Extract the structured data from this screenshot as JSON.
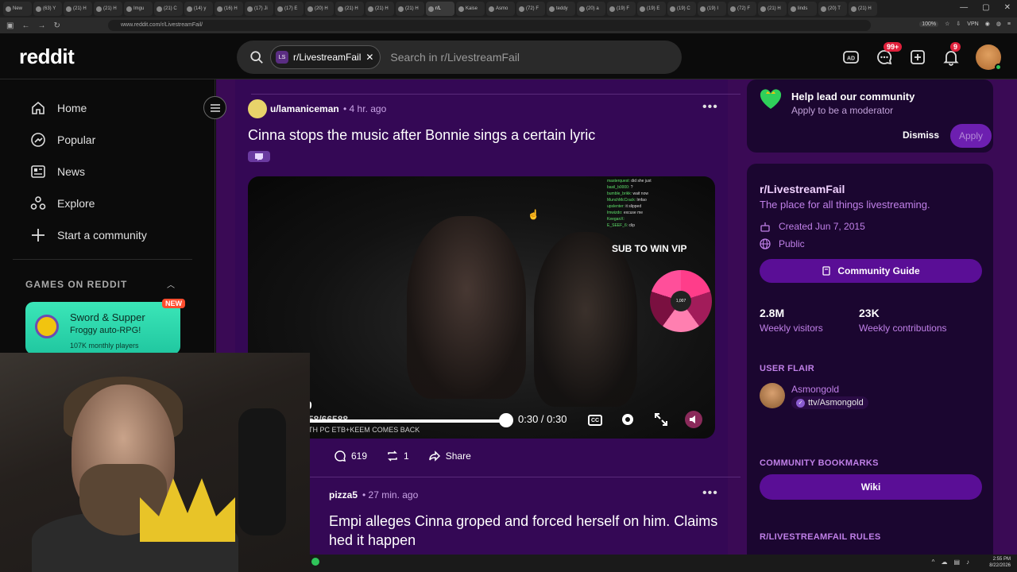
{
  "browser": {
    "tabs": [
      {
        "label": "New",
        "active": false
      },
      {
        "label": "(63) Y",
        "active": false
      },
      {
        "label": "(21) H",
        "active": false
      },
      {
        "label": "(21) H",
        "active": false
      },
      {
        "label": "Imgu",
        "active": false
      },
      {
        "label": "(21) C",
        "active": false
      },
      {
        "label": "(14) y",
        "active": false
      },
      {
        "label": "(16) H",
        "active": false
      },
      {
        "label": "(17) Ji",
        "active": false
      },
      {
        "label": "(17) E",
        "active": false
      },
      {
        "label": "(20) H",
        "active": false
      },
      {
        "label": "(21) H",
        "active": false
      },
      {
        "label": "(21) H",
        "active": false
      },
      {
        "label": "(21) H",
        "active": false
      },
      {
        "label": "r/L",
        "active": true
      },
      {
        "label": "Kaise",
        "active": false
      },
      {
        "label": "Asmo",
        "active": false
      },
      {
        "label": "(72) F",
        "active": false
      },
      {
        "label": "teddy",
        "active": false
      },
      {
        "label": "(20) a",
        "active": false
      },
      {
        "label": "(19) F",
        "active": false
      },
      {
        "label": "(19) E",
        "active": false
      },
      {
        "label": "(19) C",
        "active": false
      },
      {
        "label": "(19) I",
        "active": false
      },
      {
        "label": "(72) F",
        "active": false
      },
      {
        "label": "(21) H",
        "active": false
      },
      {
        "label": "linds",
        "active": false
      },
      {
        "label": "(20) T",
        "active": false
      },
      {
        "label": "(21) H",
        "active": false
      }
    ],
    "url": "www.reddit.com/r/LivestreamFail/",
    "zoom": "100%",
    "vpn": "VPN"
  },
  "header": {
    "logo": "reddit",
    "search_chip": "r/LivestreamFail",
    "search_chip_icon_text": "LS",
    "search_placeholder": "Search in r/LivestreamFail",
    "chat_badge": "99+",
    "notif_badge": "9"
  },
  "sidebar": {
    "items": [
      {
        "label": "Home",
        "icon": "home-icon"
      },
      {
        "label": "Popular",
        "icon": "popular-icon"
      },
      {
        "label": "News",
        "icon": "news-icon"
      },
      {
        "label": "Explore",
        "icon": "explore-icon"
      },
      {
        "label": "Start a community",
        "icon": "plus-icon"
      }
    ],
    "games_heading": "GAMES ON REDDIT",
    "game": {
      "title": "Sword & Supper",
      "subtitle": "Froggy auto-RPG!",
      "users": "107K monthly players",
      "badge": "NEW"
    }
  },
  "posts": [
    {
      "user": "u/lamaniceman",
      "time": "4 hr. ago",
      "title": "Cinna stops the music after Bonnie sings a certain lyric",
      "video": {
        "overlay_text": "SUB TO WIN VIP",
        "time": "0:30 / 0:30",
        "progress": 1.0,
        "caption_text": "TH PC ETB+KEEM COMES BACK",
        "counter_text": "58/66588",
        "wheel_text": "1,007",
        "left_digit": "50",
        "chat": [
          {
            "name": "masterquest:",
            "msg": "did she just"
          },
          {
            "name": "basil_b0000:",
            "msg": "?"
          },
          {
            "name": "bumble_brikk:",
            "msg": "wait now"
          },
          {
            "name": "MunchMcCrack:",
            "msg": "lmfao"
          },
          {
            "name": "upslenter:",
            "msg": "it slipped"
          },
          {
            "name": "lmwizdo:",
            "msg": "excuse me"
          },
          {
            "name": "KeeganX:",
            "msg": ""
          },
          {
            "name": "E_SEEF_6:",
            "msg": "clip"
          }
        ]
      },
      "comments": "619",
      "reposts": "1",
      "share": "Share"
    },
    {
      "user": "pizza5",
      "time": "27 min. ago",
      "title_line1": "Empi alleges Cinna groped and forced herself on him. Claims",
      "title_line2": "hed it happen"
    }
  ],
  "right_rail": {
    "mod_title": "Help lead our community",
    "mod_sub": "Apply to be a moderator",
    "dismiss": "Dismiss",
    "apply": "Apply",
    "sub_name": "r/LivestreamFail",
    "sub_desc": "The place for all things livestreaming.",
    "created": "Created Jun 7, 2015",
    "visibility": "Public",
    "guide_btn": "Community Guide",
    "visitors_num": "2.8M",
    "visitors_lbl": "Weekly visitors",
    "contrib_num": "23K",
    "contrib_lbl": "Weekly contributions",
    "flair_head": "USER FLAIR",
    "flair_name": "Asmongold",
    "flair_tag": "ttv/Asmongold",
    "bookmarks_head": "COMMUNITY BOOKMARKS",
    "wiki": "Wiki",
    "rules_head": "R/LIVESTREAMFAIL RULES"
  },
  "taskbar": {
    "time": "2:55 PM",
    "date": "8/22/2026"
  }
}
